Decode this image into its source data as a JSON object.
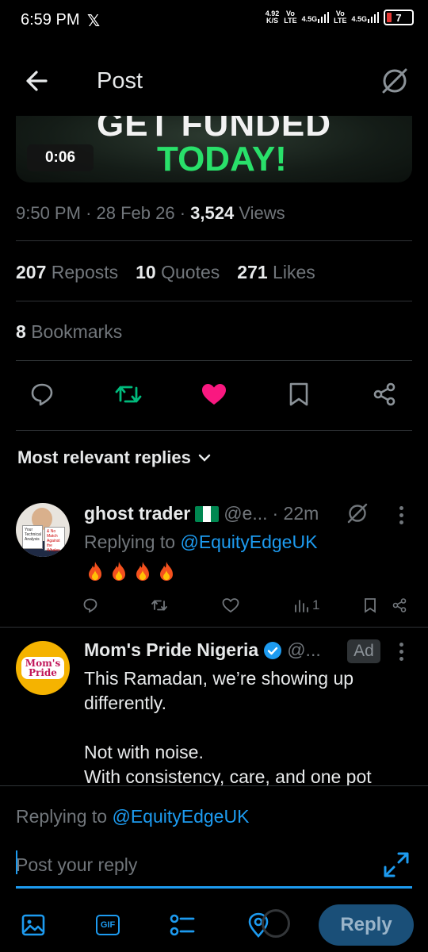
{
  "status_bar": {
    "time": "6:59 PM",
    "x_logo": "𝕏",
    "net_speed_value": "4.92",
    "net_speed_unit": "K/S",
    "sim1_label": "Vo",
    "sim1_sub": "LTE",
    "sim1_net": "4.5G",
    "sim2_label": "Vo",
    "sim2_sub": "LTE",
    "sim2_net": "4.5G",
    "battery": "7"
  },
  "header": {
    "title": "Post"
  },
  "media": {
    "line1": "GET FUNDED",
    "line2": "TODAY!",
    "duration": "0:06"
  },
  "post_meta": {
    "time": "9:50 PM",
    "date": "28 Feb 26",
    "views_count": "3,524",
    "views_label": "Views"
  },
  "stats": {
    "reposts_count": "207",
    "reposts_label": "Reposts",
    "quotes_count": "10",
    "quotes_label": "Quotes",
    "likes_count": "271",
    "likes_label": "Likes",
    "bookmarks_count": "8",
    "bookmarks_label": "Bookmarks"
  },
  "colors": {
    "accent": "#1d9bf0",
    "like": "#f91880",
    "repost": "#00ba7c",
    "muted": "#71767b"
  },
  "replies_filter": "Most relevant replies",
  "reply1": {
    "name": "ghost trader",
    "handle": "@e...",
    "time": "· 22m",
    "replying_prefix": "Replying to",
    "replying_handle": "@EquityEdgeUK",
    "views": "1",
    "avatar_sign1": "Your Technical Analysis",
    "avatar_sign2": "& No Match Against the Whales"
  },
  "reply2": {
    "name": "Mom's Pride Nigeria",
    "handle": "@...",
    "ad_label": "Ad",
    "logo_line1": "Mom's",
    "logo_line2": "Pride",
    "text1": "This Ramadan, we’re showing up differently.",
    "text2": "Not with noise.",
    "text3": "With consistency, care, and one pot"
  },
  "compose": {
    "replying_prefix": "Replying to",
    "replying_handle": "@EquityEdgeUK",
    "placeholder": "Post your reply",
    "gif_label": "GIF",
    "reply_button": "Reply"
  }
}
